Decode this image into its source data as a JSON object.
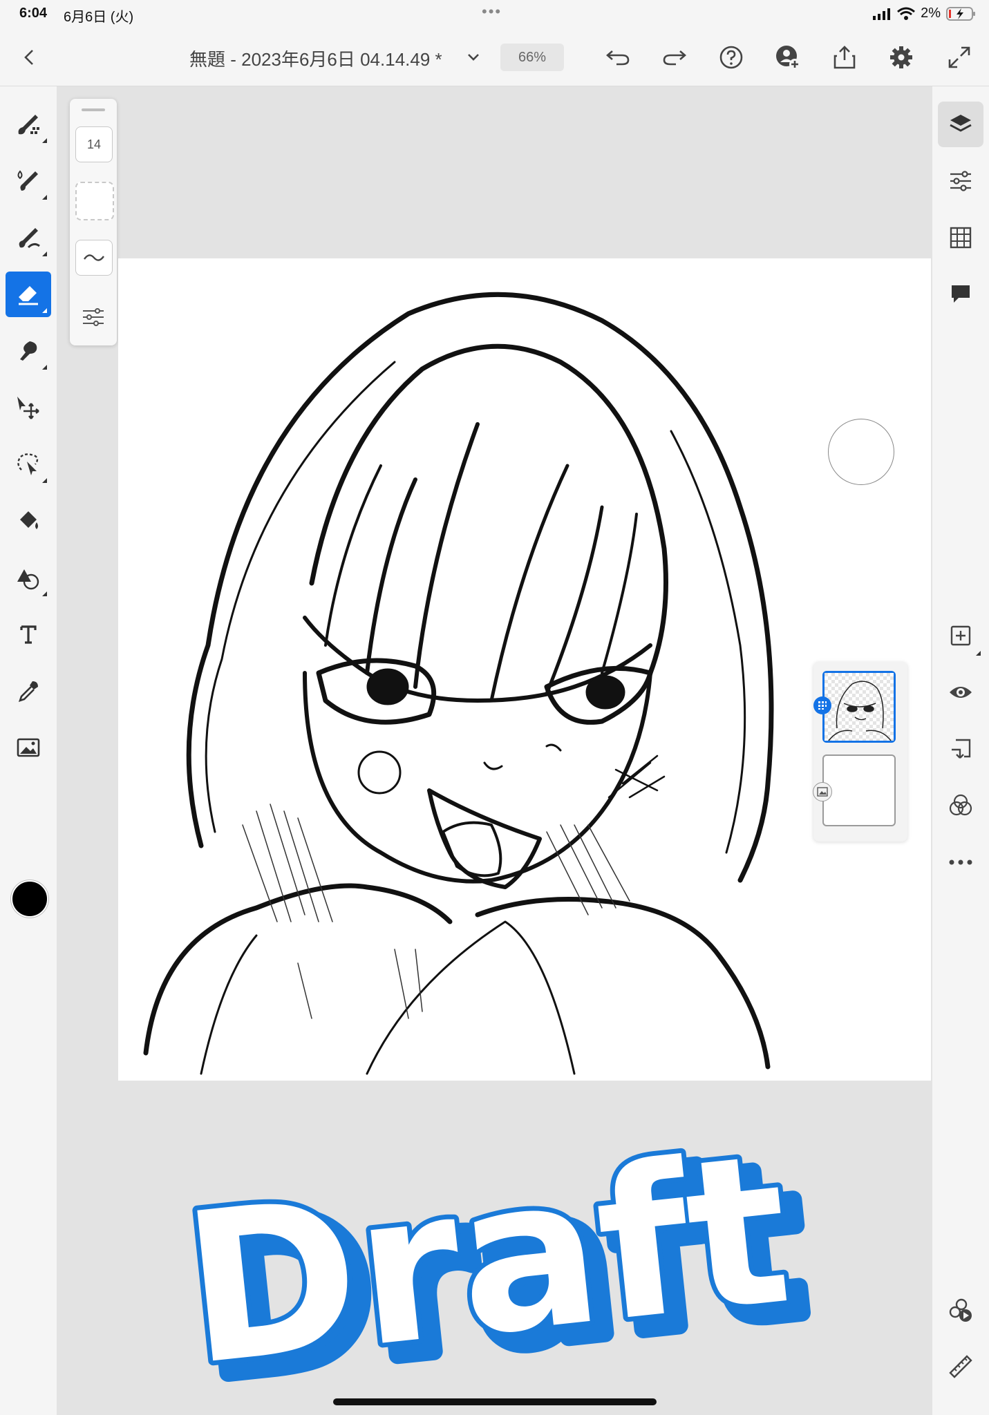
{
  "status_bar": {
    "time": "6:04",
    "date": "6月6日 (火)",
    "battery": "2%"
  },
  "title_bar": {
    "document_title": "無題 - 2023年6月6日 04.14.49 *",
    "zoom": "66%"
  },
  "brush_panel": {
    "size": "14"
  },
  "left_tools": [
    "pixel-brush",
    "live-brush",
    "vector-brush",
    "eraser",
    "smudge",
    "transform",
    "selection",
    "fill",
    "shape",
    "text",
    "eyedropper",
    "image"
  ],
  "active_tool": "eraser",
  "current_color": "#000000",
  "right_tools": [
    "layers",
    "layer-properties",
    "grid",
    "comments",
    "add-layer",
    "visibility",
    "merge-down",
    "blend-mode",
    "more"
  ],
  "watermark": {
    "text": "Draft",
    "fill": "#ffffff",
    "outline": "#1a7ad8"
  },
  "accent_color": "#1473e6"
}
